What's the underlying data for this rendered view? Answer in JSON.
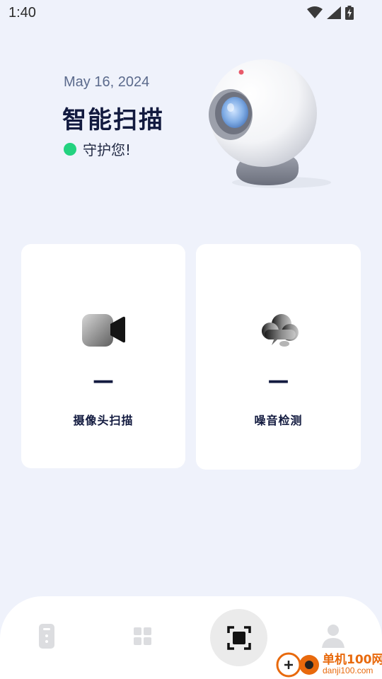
{
  "status_bar": {
    "time": "1:40",
    "icons": [
      "wifi-icon",
      "signal-icon",
      "battery-charging-icon"
    ]
  },
  "hero": {
    "date": "May 16, 2024",
    "title": "智能扫描",
    "status_text": "守护您!",
    "status_color": "#23d27f",
    "illustration": "security-camera-illustration"
  },
  "cards": [
    {
      "icon": "video-camera-icon",
      "value": "—",
      "label": "摄像头扫描"
    },
    {
      "icon": "sound-cloud-icon",
      "value": "—",
      "label": "噪音检测"
    }
  ],
  "bottom_nav": {
    "items": [
      {
        "icon": "device-icon",
        "active": false
      },
      {
        "icon": "apps-grid-icon",
        "active": false
      },
      {
        "icon": "scan-icon",
        "active": true
      },
      {
        "icon": "profile-icon",
        "active": false
      }
    ]
  },
  "watermark": {
    "title": "单机100网",
    "url": "danji100.com"
  },
  "colors": {
    "background": "#eff2fb",
    "primary_text": "#121a3f",
    "date_text": "#5b6a8c",
    "status_green": "#23d27f",
    "watermark_orange": "#e8690c"
  }
}
